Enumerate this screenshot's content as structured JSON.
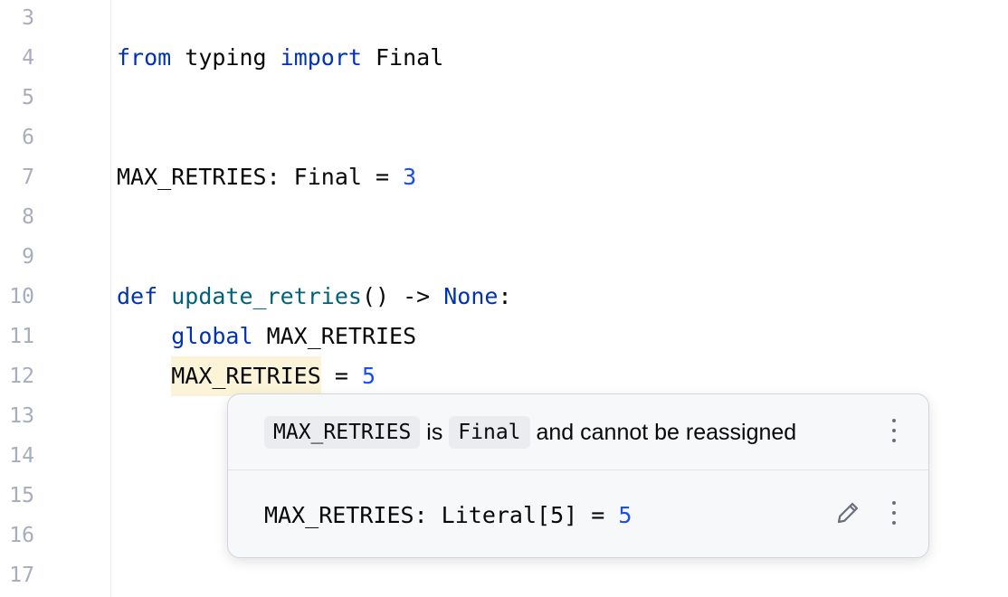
{
  "editor": {
    "line_numbers": [
      "3",
      "4",
      "5",
      "6",
      "7",
      "8",
      "9",
      "10",
      "11",
      "12",
      "13",
      "14",
      "15",
      "16",
      "17"
    ],
    "code": {
      "l4": {
        "from": "from",
        "module": " typing ",
        "import": "import",
        "name": " Final"
      },
      "l7": {
        "text": "MAX_RETRIES: Final = ",
        "num": "3"
      },
      "l10": {
        "def": "def",
        "fn": "update_retries",
        "mid": "() -> ",
        "ret": "None",
        "end": ":"
      },
      "l11": {
        "indent": "    ",
        "global": "global",
        "rest": " MAX_RETRIES"
      },
      "l12": {
        "indent": "    ",
        "target": "MAX_RETRIES",
        "rest": " = ",
        "num": "5"
      }
    }
  },
  "popup": {
    "message": {
      "var": "MAX_RETRIES",
      "is": " is ",
      "type": "Final",
      "rest": " and cannot be reassigned"
    },
    "signature": {
      "text": "MAX_RETRIES: Literal[5] = ",
      "num": "5"
    },
    "icons": {
      "more": "more-vertical-icon",
      "edit": "pencil-icon"
    }
  }
}
